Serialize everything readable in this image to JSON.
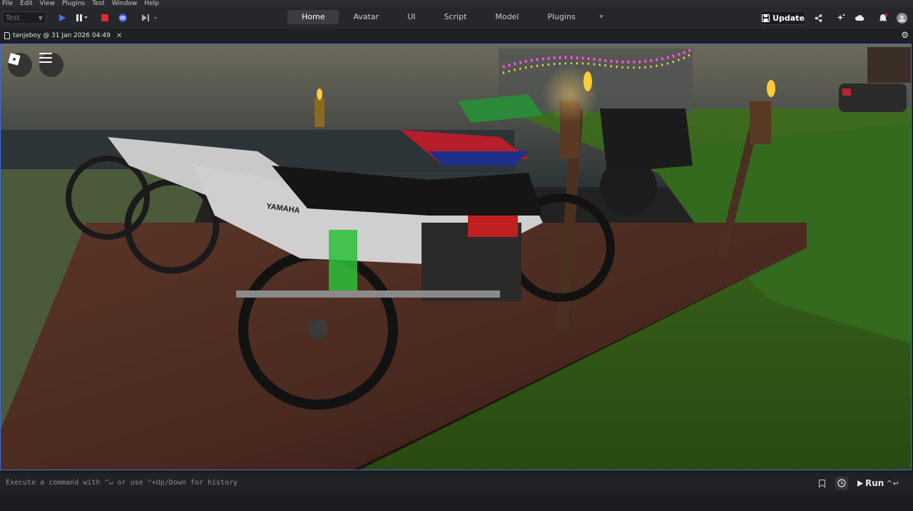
{
  "menu": [
    "File",
    "Edit",
    "View",
    "Plugins",
    "Test",
    "Window",
    "Help"
  ],
  "toolbar": {
    "mode_select": "Test",
    "tabs": [
      "Home",
      "Avatar",
      "UI",
      "Script",
      "Model",
      "Plugins"
    ],
    "active_tab": "Home",
    "update_label": "Update"
  },
  "document": {
    "tab_title": "tanjeboy @ 31 Jan 2026 04:49"
  },
  "viewport": {
    "bike_brand": "YAMAHA"
  },
  "command_bar": {
    "placeholder": "Execute a command with ^↵ or use ^+Up/Down for history",
    "run_label": "Run",
    "run_shortcut": "^↵"
  },
  "colors": {
    "accent_border": "#3f6dd9",
    "toolbar_bg": "#25272b",
    "active_tab_bg": "#3a3c41",
    "stop_red": "#e02b2b",
    "play_blue": "#4a6cf7"
  }
}
